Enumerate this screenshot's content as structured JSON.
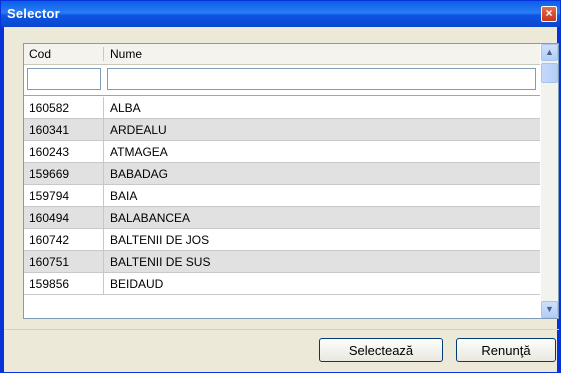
{
  "window": {
    "title": "Selector",
    "close_glyph": "×"
  },
  "grid": {
    "columns": [
      {
        "label": "Cod"
      },
      {
        "label": "Nume"
      }
    ],
    "filter": {
      "cod_value": "",
      "nume_value": ""
    },
    "rows": [
      {
        "cod": "160582",
        "nume": "ALBA"
      },
      {
        "cod": "160341",
        "nume": "ARDEALU"
      },
      {
        "cod": "160243",
        "nume": "ATMAGEA"
      },
      {
        "cod": "159669",
        "nume": "BABADAG"
      },
      {
        "cod": "159794",
        "nume": "BAIA"
      },
      {
        "cod": "160494",
        "nume": "BALABANCEA"
      },
      {
        "cod": "160742",
        "nume": "BALTENII DE JOS"
      },
      {
        "cod": "160751",
        "nume": "BALTENII DE SUS"
      },
      {
        "cod": "159856",
        "nume": "BEIDAUD"
      }
    ],
    "scroll": {
      "up_glyph": "▲",
      "down_glyph": "▼"
    }
  },
  "buttons": {
    "select": "Selectează",
    "cancel": "Renunţă"
  },
  "colors": {
    "titlebar": "#0a5fe8",
    "alt_row": "#e1e1e1",
    "frame": "#ece9d8"
  }
}
